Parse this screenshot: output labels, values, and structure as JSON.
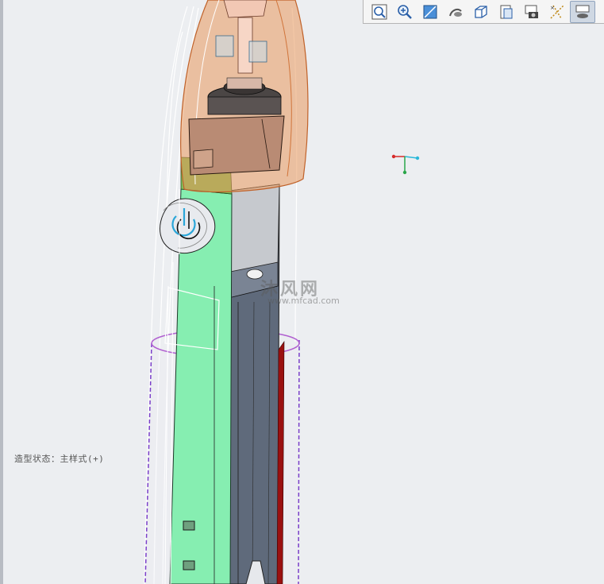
{
  "toolbar": {
    "buttons": [
      {
        "icon": "zoom-fit-icon"
      },
      {
        "icon": "zoom-in-icon"
      },
      {
        "icon": "zoom-area-icon"
      },
      {
        "icon": "rotate-view-icon"
      },
      {
        "icon": "view-orientation-icon"
      },
      {
        "icon": "display-style-icon"
      },
      {
        "icon": "camera-screenshot-icon"
      },
      {
        "icon": "datum-display-icon"
      },
      {
        "icon": "view-manager-icon",
        "active": true
      }
    ]
  },
  "status": {
    "model_state": "造型状态：主样式(+)"
  },
  "watermark": {
    "name": "沐风网",
    "url": "www.mfcad.com"
  },
  "colors": {
    "background": "#eceef1",
    "shell_orange": "#e9995c",
    "green_part": "#86eeb1",
    "body_gray": "#5c6677",
    "sleeve_purple": "#a050c0",
    "accent_red": "#9a1010"
  }
}
